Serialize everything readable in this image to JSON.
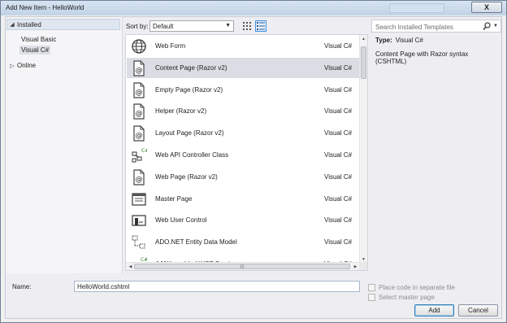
{
  "window": {
    "title": "Add New Item - HelloWorld",
    "close_glyph": "X"
  },
  "tree": {
    "installed_label": "Installed",
    "sub_items": [
      "Visual Basic",
      "Visual C#"
    ],
    "online_label": "Online"
  },
  "toolbar": {
    "sort_label": "Sort by:",
    "sort_value": "Default"
  },
  "search": {
    "placeholder": "Search Installed Templates"
  },
  "templates": [
    {
      "name": "Web Form",
      "lang": "Visual C#",
      "icon": "globe-icon"
    },
    {
      "name": "Content Page (Razor v2)",
      "lang": "Visual C#",
      "icon": "razor-page-icon"
    },
    {
      "name": "Empty Page (Razor v2)",
      "lang": "Visual C#",
      "icon": "razor-page-icon"
    },
    {
      "name": "Helper (Razor v2)",
      "lang": "Visual C#",
      "icon": "razor-page-icon"
    },
    {
      "name": "Layout Page (Razor v2)",
      "lang": "Visual C#",
      "icon": "razor-page-icon"
    },
    {
      "name": "Web API Controller Class",
      "lang": "Visual C#",
      "icon": "controller-class-icon"
    },
    {
      "name": "Web Page (Razor v2)",
      "lang": "Visual C#",
      "icon": "razor-page-icon"
    },
    {
      "name": "Master Page",
      "lang": "Visual C#",
      "icon": "master-page-icon"
    },
    {
      "name": "Web User Control",
      "lang": "Visual C#",
      "icon": "user-control-icon"
    },
    {
      "name": "ADO.NET Entity Data Model",
      "lang": "Visual C#",
      "icon": "entity-model-icon"
    },
    {
      "name": "AJAX-enabled WCF Service",
      "lang": "Visual C#",
      "icon": "wcf-service-icon"
    }
  ],
  "selected_index": 1,
  "detail": {
    "type_label": "Type:",
    "type_value": "Visual C#",
    "description": "Content Page with Razor syntax (CSHTML)"
  },
  "bottom": {
    "name_label": "Name:",
    "name_value": "HelloWorld.cshtml",
    "checkbox_separate": "Place code in separate file",
    "checkbox_master": "Select master page",
    "add_label": "Add",
    "cancel_label": "Cancel"
  },
  "colors": {
    "selection": "#dadde3",
    "title_gradient_top": "#d6e3f1",
    "accent": "#3d8ee0"
  }
}
